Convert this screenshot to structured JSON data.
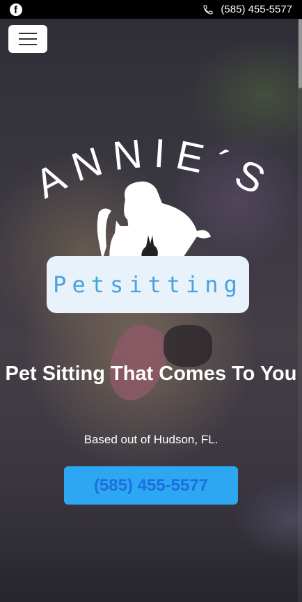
{
  "topbar": {
    "phone": "(585) 455-5577",
    "facebook_icon": "facebook-icon",
    "phone_icon": "phone-icon"
  },
  "logo": {
    "arc_text": "ANNIE´S",
    "tagline": "Petsitting"
  },
  "hero": {
    "headline": "Pet Sitting That Comes To You",
    "subtext": "Based out of Hudson, FL.",
    "cta_label": "(585) 455-5577"
  },
  "colors": {
    "accent": "#2ea7f2",
    "cta_text": "#1d6fe0",
    "logo_text": "#4aa3de",
    "logo_box": "#e8f2fb"
  }
}
